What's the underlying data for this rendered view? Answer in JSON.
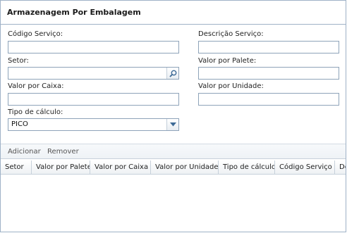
{
  "panel": {
    "title": "Armazenagem Por Embalagem"
  },
  "form": {
    "codigo_servico": {
      "label": "Código Serviço:",
      "value": ""
    },
    "descricao_servico": {
      "label": "Descrição Serviço:",
      "value": ""
    },
    "setor": {
      "label": "Setor:",
      "value": "",
      "icon": "search-icon"
    },
    "valor_palete": {
      "label": "Valor por Palete:",
      "value": ""
    },
    "valor_caixa": {
      "label": "Valor por Caixa:",
      "value": ""
    },
    "valor_unidade": {
      "label": "Valor por Unidade:",
      "value": ""
    },
    "tipo_calculo": {
      "label": "Tipo de cálculo:",
      "value": "PICO",
      "icon": "chevron-down-icon"
    }
  },
  "toolbar": {
    "add_label": "Adicionar",
    "remove_label": "Remover"
  },
  "grid": {
    "columns": [
      "Setor",
      "Valor por Palete",
      "Valor por Caixa",
      "Valor por Unidade",
      "Tipo de cálculo",
      "Código Serviço",
      "De"
    ]
  }
}
